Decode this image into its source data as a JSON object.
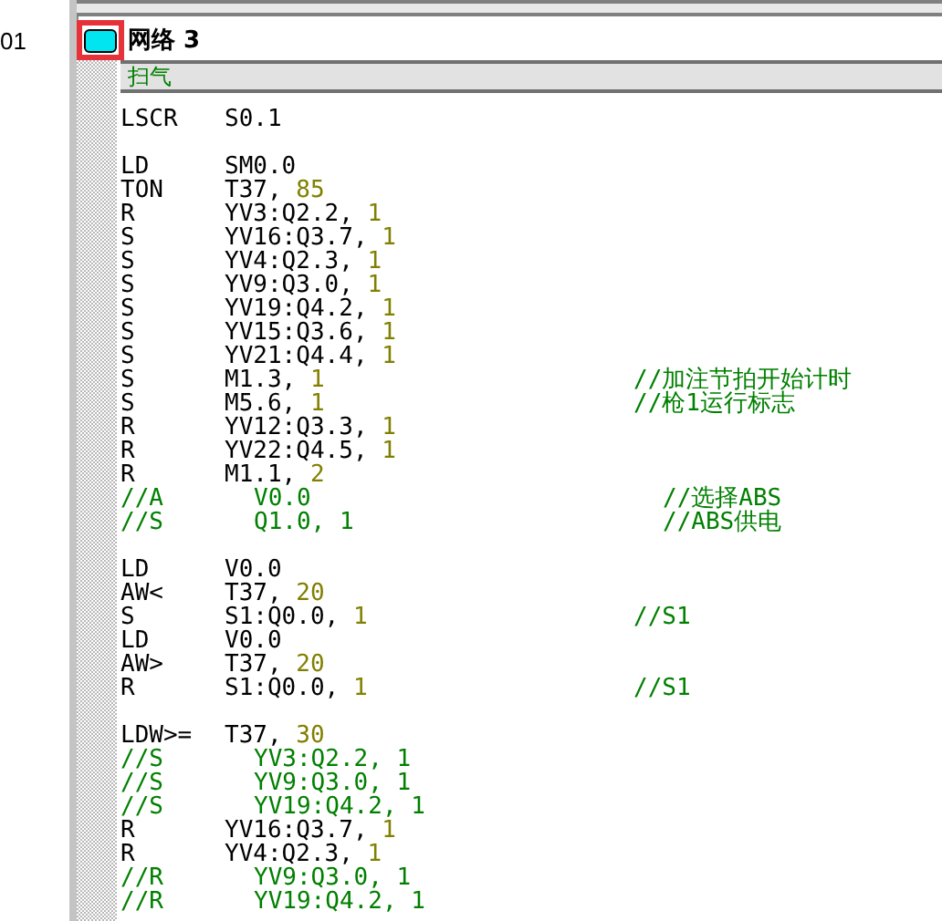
{
  "line_number": "01",
  "network": {
    "title": "网络 3",
    "highlighted": true,
    "comment": "扫气"
  },
  "lines": [
    {
      "kind": "code",
      "op": "LSCR",
      "operand": "S0.1"
    },
    {
      "kind": "blank"
    },
    {
      "kind": "code",
      "op": "LD",
      "operand": "SM0.0"
    },
    {
      "kind": "code",
      "op": "TON",
      "operand": "T37,",
      "value": "85"
    },
    {
      "kind": "code",
      "op": "R",
      "operand": "YV3:Q2.2,",
      "value": "1"
    },
    {
      "kind": "code",
      "op": "S",
      "operand": "YV16:Q3.7,",
      "value": "1"
    },
    {
      "kind": "code",
      "op": "S",
      "operand": "YV4:Q2.3,",
      "value": "1"
    },
    {
      "kind": "code",
      "op": "S",
      "operand": "YV9:Q3.0,",
      "value": "1"
    },
    {
      "kind": "code",
      "op": "S",
      "operand": "YV19:Q4.2,",
      "value": "1"
    },
    {
      "kind": "code",
      "op": "S",
      "operand": "YV15:Q3.6,",
      "value": "1"
    },
    {
      "kind": "code",
      "op": "S",
      "operand": "YV21:Q4.4,",
      "value": "1"
    },
    {
      "kind": "code",
      "op": "S",
      "operand": "M1.3,",
      "value": "1",
      "comment": "//加注节拍开始计时"
    },
    {
      "kind": "code",
      "op": "S",
      "operand": "M5.6,",
      "value": "1",
      "comment": "//枪1运行标志"
    },
    {
      "kind": "code",
      "op": "R",
      "operand": "YV12:Q3.3,",
      "value": "1"
    },
    {
      "kind": "code",
      "op": "R",
      "operand": "YV22:Q4.5,",
      "value": "1"
    },
    {
      "kind": "code",
      "op": "R",
      "operand": "M1.1,",
      "value": "2"
    },
    {
      "kind": "disabled",
      "op": "//A",
      "operand": "V0.0",
      "comment": "//选择ABS"
    },
    {
      "kind": "disabled",
      "op": "//S",
      "operand": "Q1.0, 1",
      "comment": "//ABS供电"
    },
    {
      "kind": "blank"
    },
    {
      "kind": "code",
      "op": "LD",
      "operand": "V0.0"
    },
    {
      "kind": "code",
      "op": "AW<",
      "operand": "T37,",
      "value": "20"
    },
    {
      "kind": "code",
      "op": "S",
      "operand": "S1:Q0.0,",
      "value": "1",
      "comment": "//S1"
    },
    {
      "kind": "code",
      "op": "LD",
      "operand": "V0.0"
    },
    {
      "kind": "code",
      "op": "AW>",
      "operand": "T37,",
      "value": "20"
    },
    {
      "kind": "code",
      "op": "R",
      "operand": "S1:Q0.0,",
      "value": "1",
      "comment": "//S1"
    },
    {
      "kind": "blank"
    },
    {
      "kind": "code",
      "op": "LDW>=",
      "operand": "T37,",
      "value": "30"
    },
    {
      "kind": "disabled",
      "op": "//S",
      "operand": "YV3:Q2.2, 1"
    },
    {
      "kind": "disabled",
      "op": "//S",
      "operand": "YV9:Q3.0, 1"
    },
    {
      "kind": "disabled",
      "op": "//S",
      "operand": "YV19:Q4.2, 1"
    },
    {
      "kind": "code",
      "op": "R",
      "operand": "YV16:Q3.7,",
      "value": "1"
    },
    {
      "kind": "code",
      "op": "R",
      "operand": "YV4:Q2.3,",
      "value": "1"
    },
    {
      "kind": "disabled",
      "op": "//R",
      "operand": "YV9:Q3.0, 1"
    },
    {
      "kind": "disabled",
      "op": "//R",
      "operand": "YV19:Q4.2, 1"
    }
  ]
}
